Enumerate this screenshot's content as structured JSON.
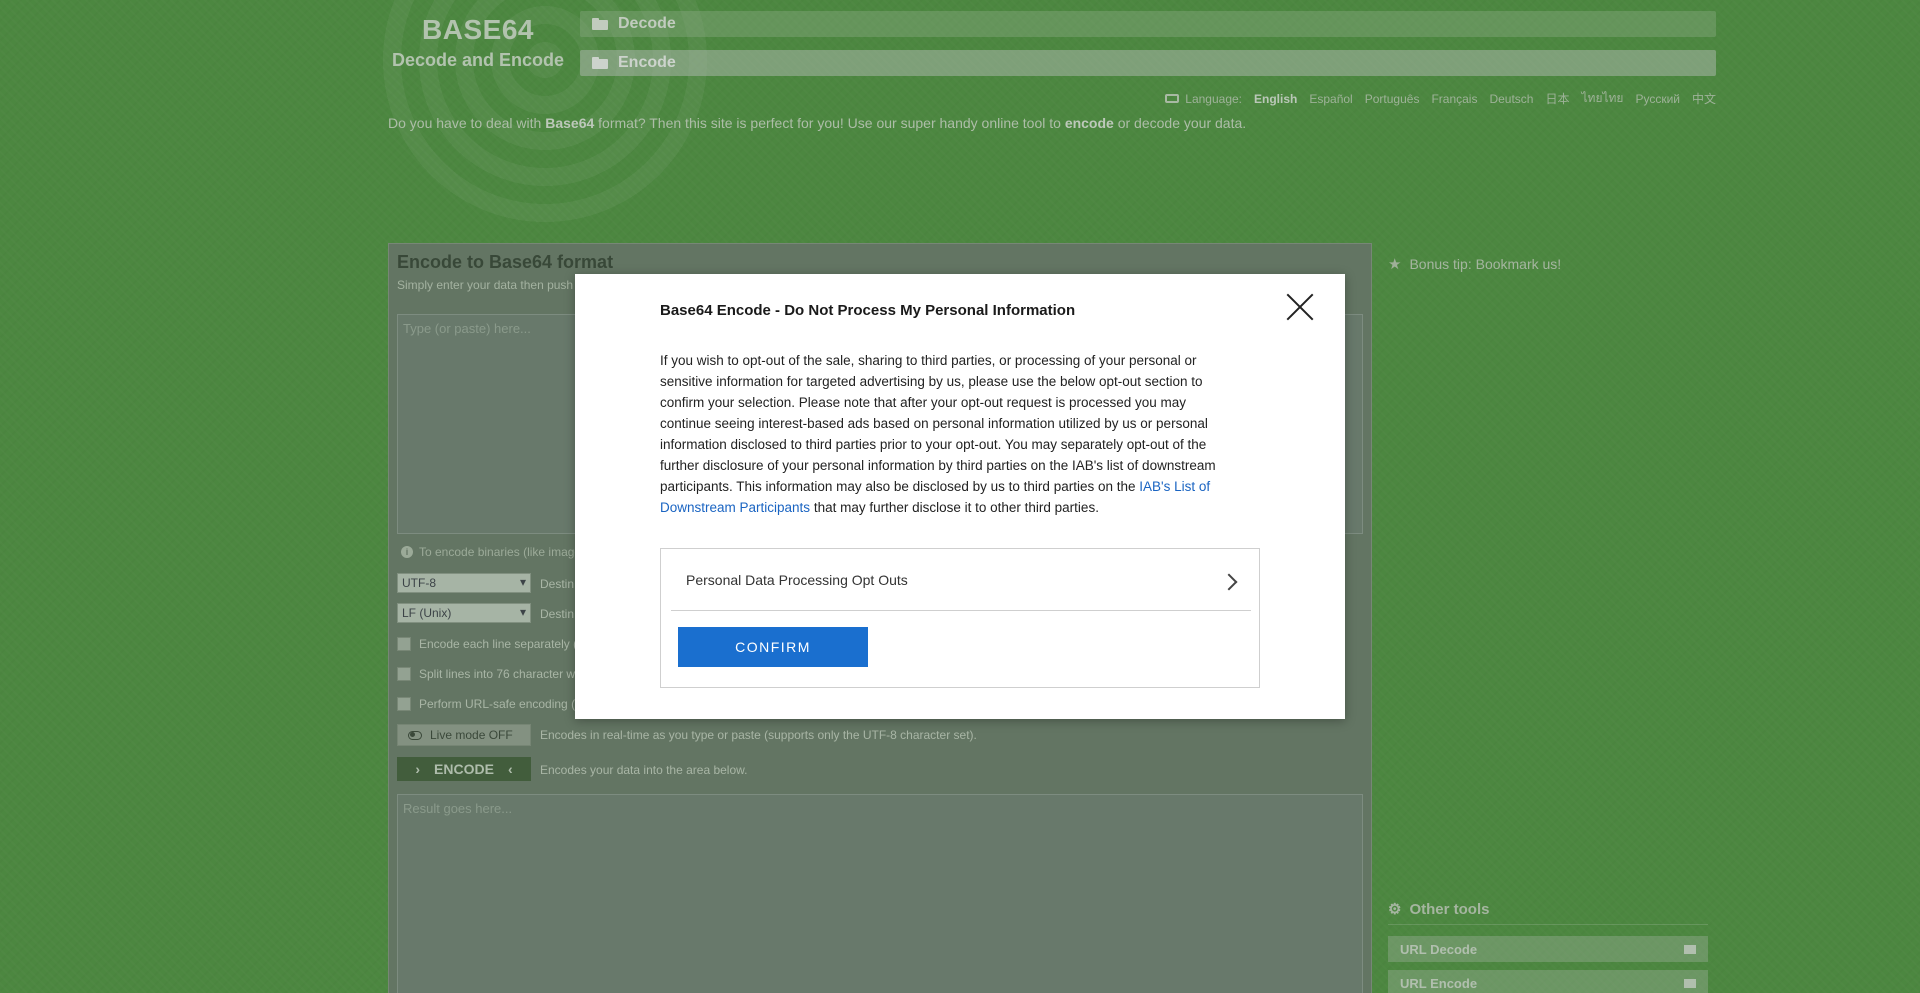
{
  "header": {
    "logo_title": "BASE64",
    "logo_subtitle": "Decode and Encode",
    "nav": {
      "decode": "Decode",
      "encode": "Encode"
    }
  },
  "languages": {
    "label": "Language:",
    "items": [
      "English",
      "Español",
      "Português",
      "Français",
      "Deutsch",
      "日本",
      "ไทยไทย",
      "Русский",
      "中文"
    ],
    "active": "English"
  },
  "intro": {
    "part1": "Do you have to deal with ",
    "bold1": "Base64",
    "part2": " format? Then this site is perfect for you! Use our super handy online tool to ",
    "bold2": "encode",
    "part3": " or decode your data."
  },
  "main": {
    "title": "Encode to Base64 format",
    "subtitle": "Simply enter your data then push",
    "input_placeholder": "Type (or paste) here...",
    "binary_hint": "To encode binaries (like image",
    "charset_select": "UTF-8",
    "charset_label": "Destin",
    "newline_select": "LF (Unix)",
    "newline_label": "Destin",
    "checkboxes": [
      "Encode each line separately (",
      "Split lines into 76 character w",
      "Perform URL-safe encoding ("
    ],
    "live_mode": "Live mode OFF",
    "live_desc": "Encodes in real-time as you type or paste (supports only the UTF-8 character set).",
    "encode_button": "ENCODE",
    "encode_desc": "Encodes your data into the area below.",
    "result_placeholder": "Result goes here..."
  },
  "sidebar": {
    "bonus_tip": "Bonus tip: Bookmark us!",
    "other_tools": "Other tools",
    "tools": [
      "URL Decode",
      "URL Encode"
    ]
  },
  "modal": {
    "title": "Base64 Encode - Do Not Process My Personal Information",
    "body": "If you wish to opt-out of the sale, sharing to third parties, or processing of your personal or sensitive information for targeted advertising by us, please use the below opt-out section to confirm your selection. Please note that after your opt-out request is processed you may continue seeing interest-based ads based on personal information utilized by us or personal information disclosed to third parties prior to your opt-out. You may separately opt-out of the further disclosure of your personal information by third parties on the IAB's list of downstream participants. This information may also be disclosed by us to third parties on the ",
    "link_text": "IAB's List of Downstream Participants",
    "body_end": " that may further disclose it to other third parties.",
    "optout_label": "Personal Data Processing Opt Outs",
    "confirm_button": "CONFIRM"
  }
}
